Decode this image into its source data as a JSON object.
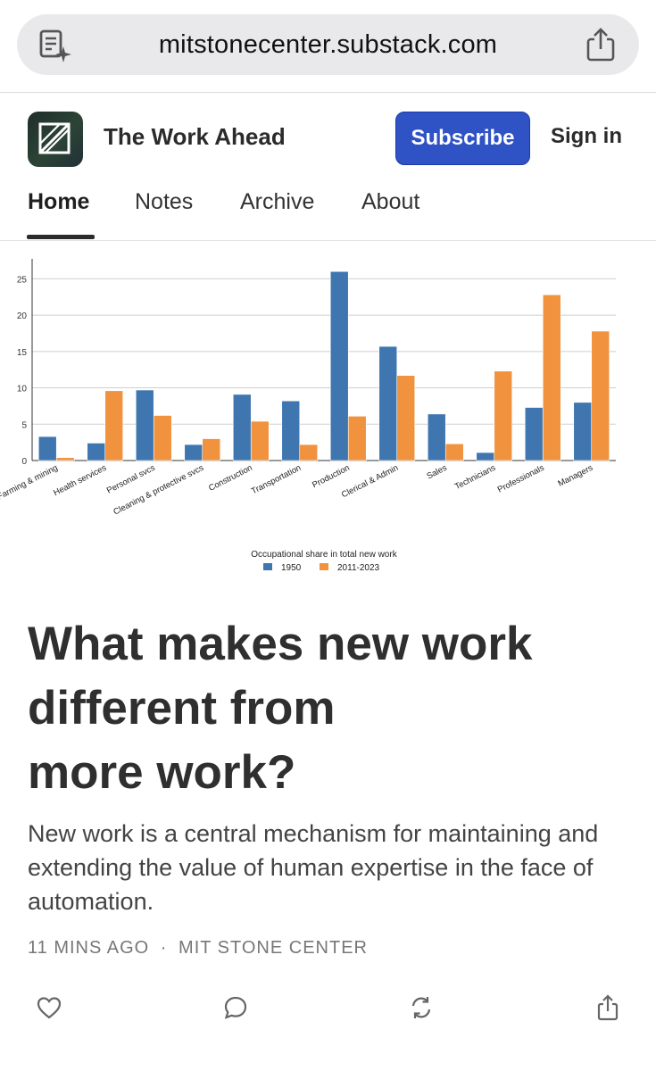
{
  "browser": {
    "url": "mitstonecenter.substack.com",
    "reader_icon": "reader-mode-icon",
    "share_icon": "share-icon"
  },
  "site": {
    "title": "The Work Ahead",
    "subscribe_label": "Subscribe",
    "signin_label": "Sign in",
    "accent_color": "#2f52c4"
  },
  "nav": {
    "items": [
      {
        "label": "Home",
        "active": true
      },
      {
        "label": "Notes",
        "active": false
      },
      {
        "label": "Archive",
        "active": false
      },
      {
        "label": "About",
        "active": false
      }
    ]
  },
  "chart_data": {
    "type": "bar",
    "title": "Occupational share in total new work",
    "categories": [
      "Farming & mining",
      "Health services",
      "Personal svcs",
      "Cleaning & protective svcs",
      "Construction",
      "Transportation",
      "Production",
      "Clerical & Admin",
      "Sales",
      "Technicians",
      "Professionals",
      "Managers"
    ],
    "series": [
      {
        "name": "1950",
        "color": "#3f76b0",
        "values": [
          3.3,
          2.4,
          9.7,
          2.2,
          9.1,
          8.2,
          26.0,
          15.7,
          6.4,
          1.1,
          7.3,
          8.0
        ]
      },
      {
        "name": "2011-2023",
        "color": "#f0923e",
        "values": [
          0.4,
          9.6,
          6.2,
          3.0,
          5.4,
          2.2,
          6.1,
          11.7,
          2.3,
          12.3,
          22.8,
          17.8
        ]
      }
    ],
    "yticks": [
      0,
      5,
      10,
      15,
      20,
      25
    ],
    "ylim": [
      0,
      27.5
    ],
    "grid": true,
    "legend_position": "bottom-center"
  },
  "article": {
    "headline": "What makes new work\ndifferent from\nmore work?",
    "subtitle": "New work is a central mechanism for maintaining and extending the value of human expertise in the face of automation.",
    "time_ago": "11 MINS AGO",
    "separator": "·",
    "author": "MIT STONE CENTER"
  },
  "actions": {
    "like_icon": "heart-icon",
    "comment_icon": "comment-icon",
    "restack_icon": "restack-icon",
    "share_icon": "share-icon"
  }
}
